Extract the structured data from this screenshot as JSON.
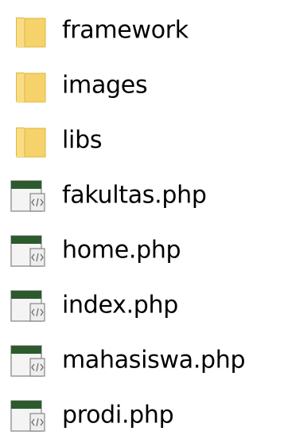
{
  "items": [
    {
      "name": "framework",
      "icon": "folder-icon"
    },
    {
      "name": "images",
      "icon": "folder-icon"
    },
    {
      "name": "libs",
      "icon": "folder-icon"
    },
    {
      "name": "fakultas.php",
      "icon": "php-file-icon"
    },
    {
      "name": "home.php",
      "icon": "php-file-icon"
    },
    {
      "name": "index.php",
      "icon": "php-file-icon"
    },
    {
      "name": "mahasiswa.php",
      "icon": "php-file-icon"
    },
    {
      "name": "prodi.php",
      "icon": "php-file-icon"
    }
  ],
  "colors": {
    "folder_fill": "#f6d26b",
    "folder_edge": "#e2b73f",
    "file_band": "#2d5a2d"
  }
}
